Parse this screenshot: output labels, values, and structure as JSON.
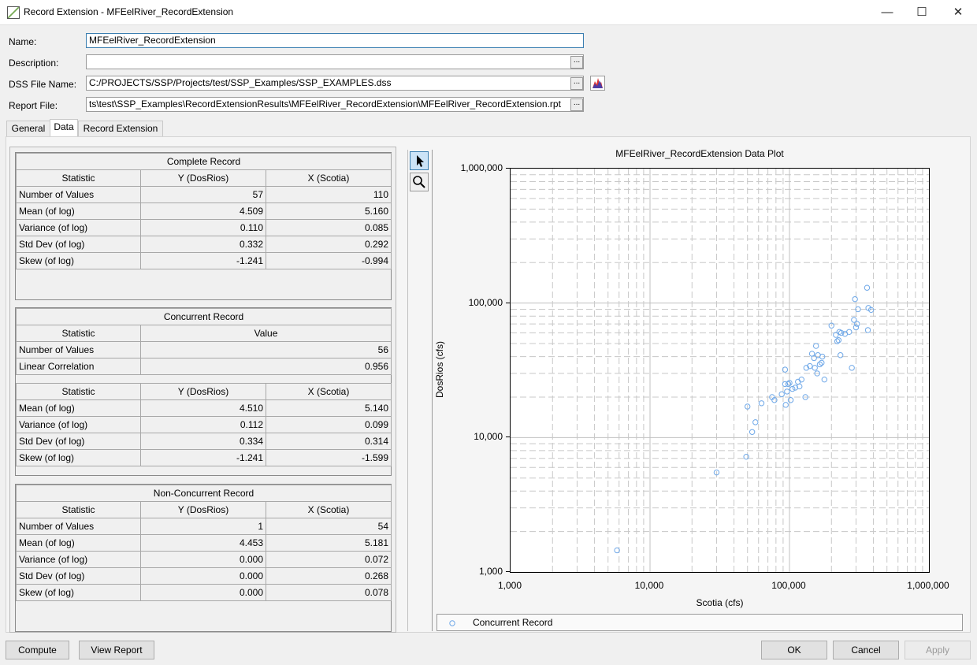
{
  "window": {
    "title": "Record Extension -  MFEelRiver_RecordExtension",
    "minimize": "—",
    "maximize": "☐",
    "close": "✕"
  },
  "form": {
    "name_label": "Name:",
    "name_value": "MFEelRiver_RecordExtension",
    "description_label": "Description:",
    "description_value": "",
    "dss_label": "DSS File Name:",
    "dss_value": "C:/PROJECTS/SSP/Projects/test/SSP_Examples/SSP_EXAMPLES.dss",
    "report_label": "Report File:",
    "report_value": "ts\\test\\SSP_Examples\\RecordExtensionResults\\MFEelRiver_RecordExtension\\MFEelRiver_RecordExtension.rpt",
    "ellipsis": "..."
  },
  "tabs": [
    "General",
    "Data",
    "Record Extension"
  ],
  "complete": {
    "title": "Complete Record",
    "headers": [
      "Statistic",
      "Y (DosRios)",
      "X (Scotia)"
    ],
    "rows": [
      [
        "Number of Values",
        "57",
        "110"
      ],
      [
        "Mean (of log)",
        "4.509",
        "5.160"
      ],
      [
        "Variance (of log)",
        "0.110",
        "0.085"
      ],
      [
        "Std Dev (of log)",
        "0.332",
        "0.292"
      ],
      [
        "Skew (of log)",
        "-1.241",
        "-0.994"
      ]
    ]
  },
  "concurrent": {
    "title": "Concurrent Record",
    "headers1": [
      "Statistic",
      "Value"
    ],
    "rows1": [
      [
        "Number of Values",
        "56"
      ],
      [
        "Linear Correlation",
        "0.956"
      ]
    ],
    "headers2": [
      "Statistic",
      "Y (DosRios)",
      "X (Scotia)"
    ],
    "rows2": [
      [
        "Mean (of log)",
        "4.510",
        "5.140"
      ],
      [
        "Variance (of log)",
        "0.112",
        "0.099"
      ],
      [
        "Std Dev (of log)",
        "0.334",
        "0.314"
      ],
      [
        "Skew (of log)",
        "-1.241",
        "-1.599"
      ]
    ]
  },
  "nonconcurrent": {
    "title": "Non-Concurrent Record",
    "headers": [
      "Statistic",
      "Y (DosRios)",
      "X (Scotia)"
    ],
    "rows": [
      [
        "Number of Values",
        "1",
        "54"
      ],
      [
        "Mean (of log)",
        "4.453",
        "5.181"
      ],
      [
        "Variance (of log)",
        "0.000",
        "0.072"
      ],
      [
        "Std Dev (of log)",
        "0.000",
        "0.268"
      ],
      [
        "Skew (of log)",
        "0.000",
        "0.078"
      ]
    ]
  },
  "tools": {
    "pointer_icon": "pointer-arrow",
    "zoom_icon": "magnifier"
  },
  "chart_data": {
    "type": "scatter",
    "title": "MFEelRiver_RecordExtension Data Plot",
    "xlabel": "Scotia (cfs)",
    "ylabel": "DosRios (cfs)",
    "xscale": "log",
    "yscale": "log",
    "xlim": [
      1000,
      1000000
    ],
    "ylim": [
      1000,
      1000000
    ],
    "xticks": [
      "1,000",
      "10,000",
      "100,000",
      "1,000,000"
    ],
    "yticks": [
      "1,000",
      "10,000",
      "100,000",
      "1,000,000"
    ],
    "grid": true,
    "legend_position": "bottom",
    "series": [
      {
        "name": "Concurrent Record",
        "color": "#6fa8e8",
        "marker": "open-circle",
        "points": [
          [
            5800,
            1450
          ],
          [
            30000,
            5500
          ],
          [
            49000,
            7200
          ],
          [
            50000,
            17000
          ],
          [
            54000,
            11000
          ],
          [
            57000,
            13000
          ],
          [
            63000,
            18000
          ],
          [
            75000,
            20000
          ],
          [
            78000,
            19000
          ],
          [
            88000,
            21000
          ],
          [
            93000,
            32000
          ],
          [
            93000,
            25000
          ],
          [
            94000,
            17500
          ],
          [
            96000,
            22000
          ],
          [
            98000,
            25000
          ],
          [
            100000,
            25500
          ],
          [
            102000,
            19000
          ],
          [
            105000,
            23000
          ],
          [
            110000,
            23500
          ],
          [
            115000,
            26000
          ],
          [
            118000,
            24000
          ],
          [
            122000,
            27000
          ],
          [
            130000,
            20000
          ],
          [
            132000,
            33000
          ],
          [
            140000,
            34000
          ],
          [
            145000,
            42000
          ],
          [
            150000,
            39000
          ],
          [
            152000,
            33000
          ],
          [
            155000,
            48000
          ],
          [
            158000,
            30000
          ],
          [
            160000,
            41000
          ],
          [
            165000,
            35000
          ],
          [
            170000,
            36000
          ],
          [
            172000,
            40000
          ],
          [
            178000,
            27000
          ],
          [
            200000,
            68000
          ],
          [
            215000,
            58000
          ],
          [
            220000,
            52000
          ],
          [
            225000,
            53000
          ],
          [
            228000,
            61000
          ],
          [
            232000,
            41000
          ],
          [
            235000,
            60000
          ],
          [
            250000,
            59000
          ],
          [
            268000,
            61000
          ],
          [
            280000,
            33000
          ],
          [
            290000,
            75000
          ],
          [
            295000,
            107000
          ],
          [
            300000,
            66000
          ],
          [
            305000,
            70000
          ],
          [
            310000,
            90000
          ],
          [
            360000,
            130000
          ],
          [
            365000,
            63000
          ],
          [
            368000,
            92000
          ],
          [
            385000,
            89000
          ]
        ]
      }
    ]
  },
  "buttons": {
    "compute": "Compute",
    "view_report": "View Report",
    "ok": "OK",
    "cancel": "Cancel",
    "apply": "Apply"
  }
}
